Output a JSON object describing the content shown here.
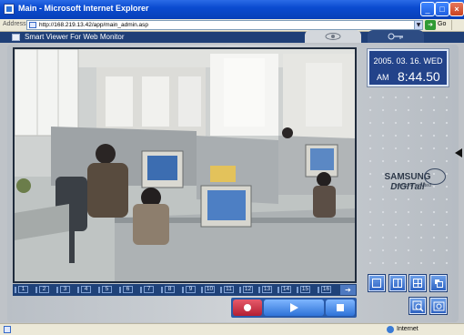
{
  "window": {
    "title": "Main - Microsoft Internet Explorer",
    "address_label": "Address",
    "url": "http://168.219.13.42/app/main_admin.asp",
    "go_label": "Go"
  },
  "app": {
    "title": "Smart Viewer For Web Monitor",
    "tabs": [
      {
        "icon": "eye-icon",
        "selected": true
      },
      {
        "icon": "key-icon",
        "selected": false
      }
    ]
  },
  "clock": {
    "date": "2005. 03. 16. WED",
    "ampm": "AM",
    "time": "8:44.50"
  },
  "brand": {
    "name_prefix": "SAMSUNG ",
    "name_suffix": "DIGITall",
    "tagline": "everyone's invited"
  },
  "channels": [
    "1",
    "2",
    "3",
    "4",
    "5",
    "6",
    "7",
    "8",
    "9",
    "10",
    "11",
    "12",
    "13",
    "14",
    "15",
    "16"
  ],
  "controls": {
    "record_icon": "record-icon",
    "play_icon": "play-icon",
    "stop_icon": "stop-icon"
  },
  "layout_buttons": [
    "single-view-icon",
    "quad-view-icon",
    "nine-view-icon",
    "sixteen-view-icon",
    "zoom-icon",
    "snapshot-icon"
  ],
  "status": {
    "zone": "Internet"
  },
  "colors": {
    "ie_blue": "#0a4bd0",
    "app_navy": "#1f3f77",
    "record_red": "#b21f33",
    "button_blue": "#2f73d8"
  }
}
